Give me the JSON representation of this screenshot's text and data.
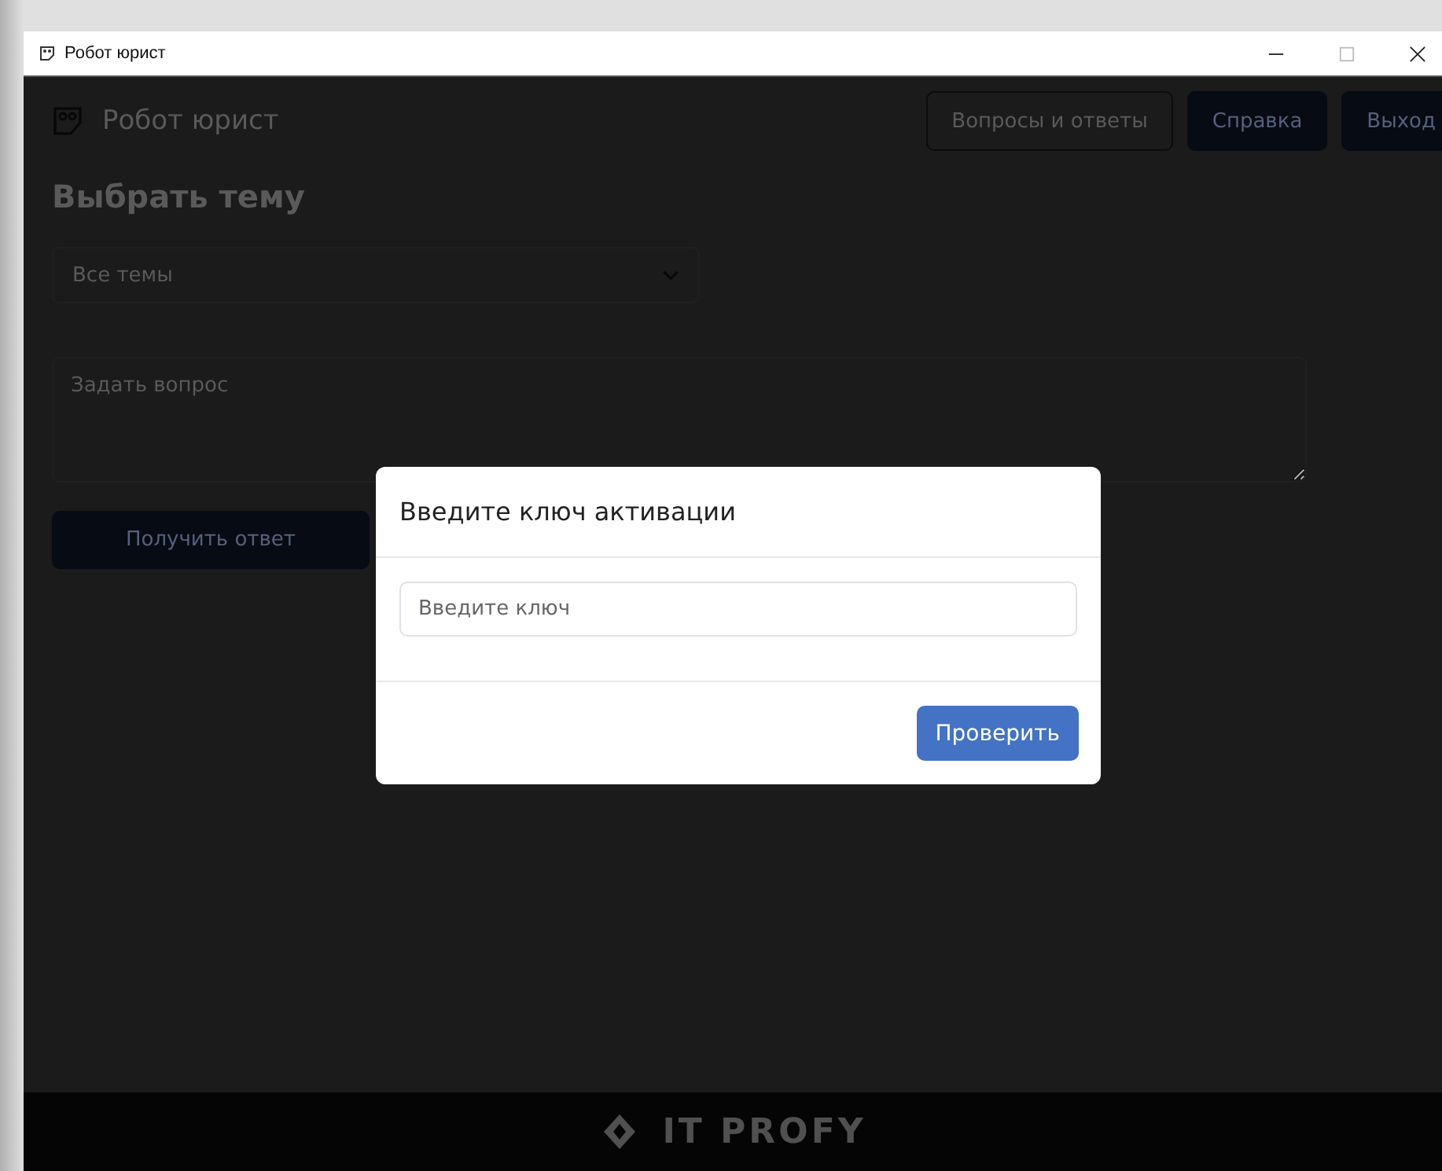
{
  "window": {
    "title": "Робот юрист"
  },
  "header": {
    "title": "Робот юрист",
    "buttons": [
      {
        "label": "Вопросы и ответы",
        "kind": "outline"
      },
      {
        "label": "Справка",
        "kind": "filled"
      },
      {
        "label": "Выход",
        "kind": "filled"
      }
    ]
  },
  "topic": {
    "heading": "Выбрать тему",
    "select_value": "Все темы"
  },
  "question": {
    "placeholder": "Задать вопрос"
  },
  "submit_button": "Получить ответ",
  "modal": {
    "title": "Введите ключ активации",
    "input": {
      "placeholder": "Введите ключ"
    },
    "button": "Проверить"
  },
  "footer": {
    "brand": "IT PROFY"
  }
}
